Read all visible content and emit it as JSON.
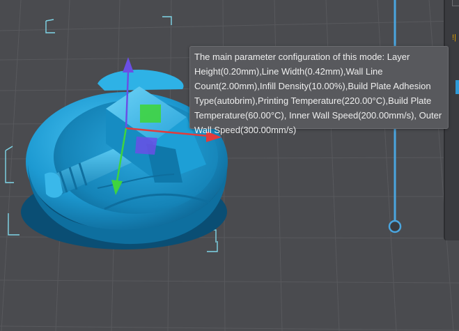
{
  "tooltip": {
    "text": "The main parameter configuration of this mode: Layer Height(0.20mm),Line Width(0.42mm),Wall Line Count(2.00mm),Infill Density(10.00%),Build Plate Adhesion Type(autobrim),Printing Temperature(220.00°C),Build Plate Temperature(60.00°C), Inner Wall Speed(200.00mm/s), Outer Wall Speed(300.00mm/s)"
  },
  "panel": {
    "warn_glyph": "!|"
  },
  "colors": {
    "background": "#4a4b4f",
    "grid_line": "#5b5c60",
    "model": "#1f9fd6",
    "model_shadow": "#0c6a99",
    "axis_x": "#e23b3b",
    "axis_y": "#3fd43f",
    "axis_z": "#6a4fe6",
    "layer_slider": "#4aa6e0"
  }
}
